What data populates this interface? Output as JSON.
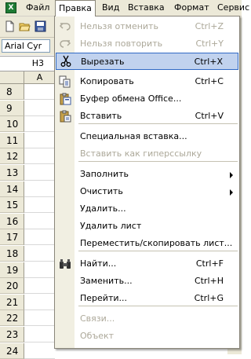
{
  "menubar": {
    "app_icon_label": "X",
    "items": [
      {
        "label": "Файл"
      },
      {
        "label": "Правка"
      },
      {
        "label": "Вид"
      },
      {
        "label": "Вставка"
      },
      {
        "label": "Формат"
      },
      {
        "label": "Сервис"
      }
    ]
  },
  "toolbar": {
    "font_name": "Arial Cyr",
    "name_box": "H3",
    "column_header": "A"
  },
  "rows": [
    "8",
    "9",
    "10",
    "11",
    "12",
    "13",
    "14",
    "15",
    "16",
    "17",
    "18",
    "19",
    "20",
    "21",
    "22",
    "23",
    "24"
  ],
  "edit_menu": {
    "items": [
      {
        "label": "Нельзя отменить",
        "shortcut": "Ctrl+Z",
        "icon": "undo-icon",
        "disabled": true
      },
      {
        "label": "Нельзя повторить",
        "shortcut": "Ctrl+Y",
        "icon": "redo-icon",
        "disabled": true
      },
      {
        "label": "Вырезать",
        "shortcut": "Ctrl+X",
        "icon": "scissors-icon",
        "highlighted": true
      },
      {
        "label": "Копировать",
        "shortcut": "Ctrl+C",
        "icon": "copy-icon"
      },
      {
        "label": "Буфер обмена Office...",
        "shortcut": "",
        "icon": "clipboard-icon"
      },
      {
        "label": "Вставить",
        "shortcut": "Ctrl+V",
        "icon": "paste-icon"
      },
      {
        "label": "Специальная вставка...",
        "shortcut": ""
      },
      {
        "label": "Вставить как гиперссылку",
        "shortcut": "",
        "disabled": true
      },
      {
        "label": "Заполнить",
        "shortcut": "",
        "submenu": true
      },
      {
        "label": "Очистить",
        "shortcut": "",
        "submenu": true
      },
      {
        "label": "Удалить...",
        "shortcut": ""
      },
      {
        "label": "Удалить лист",
        "shortcut": ""
      },
      {
        "label": "Переместить/скопировать лист...",
        "shortcut": ""
      },
      {
        "label": "Найти...",
        "shortcut": "Ctrl+F",
        "icon": "binoculars-icon"
      },
      {
        "label": "Заменить...",
        "shortcut": "Ctrl+H"
      },
      {
        "label": "Перейти...",
        "shortcut": "Ctrl+G"
      },
      {
        "label": "Связи...",
        "shortcut": "",
        "disabled": true
      },
      {
        "label": "Объект",
        "shortcut": "",
        "disabled": true
      }
    ]
  }
}
